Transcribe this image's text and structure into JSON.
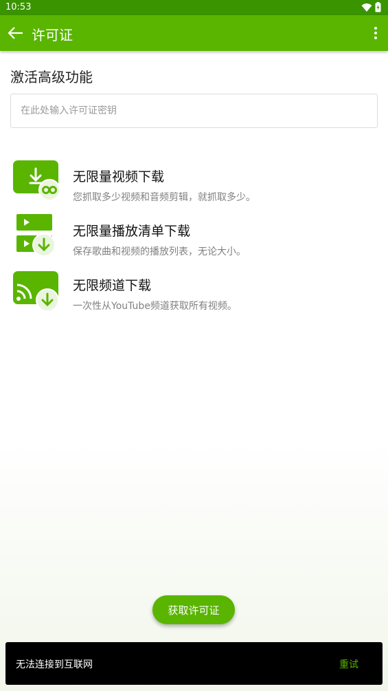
{
  "status_bar": {
    "time": "10:53"
  },
  "app_bar": {
    "title": "许可证",
    "back_icon": "arrow-left-icon",
    "menu_icon": "more-vert-icon"
  },
  "main": {
    "section_title": "激活高级功能",
    "license_input": {
      "placeholder": "在此处输入许可证密钥",
      "value": ""
    },
    "features": [
      {
        "title": "无限量视频下载",
        "desc": "您抓取多少视频和音频剪辑，就抓取多少。",
        "icon": "video-download-infinite-icon"
      },
      {
        "title": "无限量播放清单下载",
        "desc": "保存歌曲和视频的播放列表，无论大小。",
        "icon": "playlist-download-icon"
      },
      {
        "title": "无限频道下载",
        "desc": "一次性从YouTube频道获取所有视频。",
        "icon": "channel-download-icon"
      }
    ],
    "get_license_button": "获取许可证"
  },
  "snackbar": {
    "message": "无法连接到互联网",
    "action": "重试"
  },
  "colors": {
    "primary": "#59b500",
    "status_bar": "#3a9400",
    "badge_bg": "#eaf4e0"
  }
}
